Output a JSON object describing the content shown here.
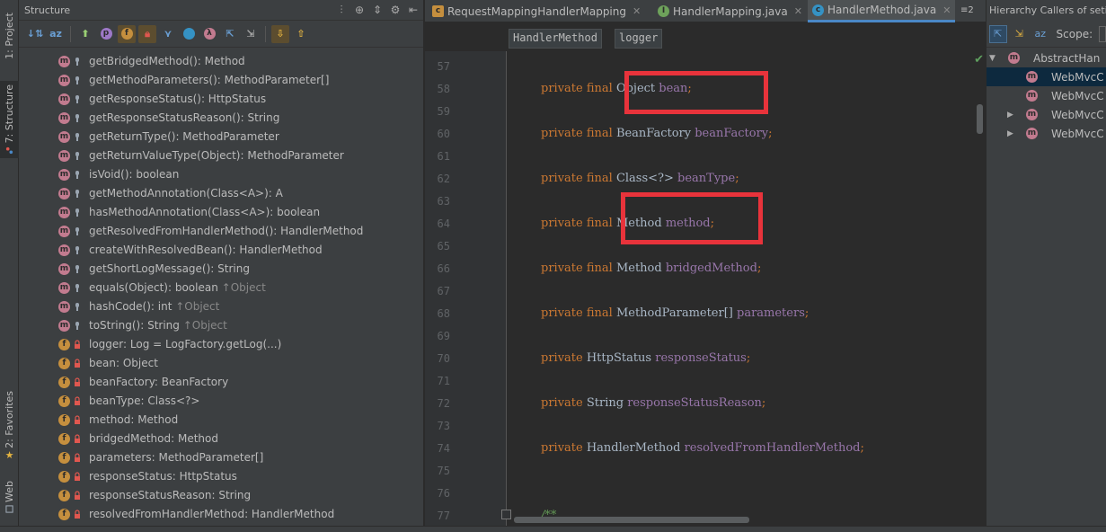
{
  "toolstrip": {
    "project_tab": "1: Project",
    "structure_tab": "7: Structure",
    "favorites_tab": "2: Favorites",
    "web_tab": "Web"
  },
  "structure": {
    "title": "Structure",
    "items": [
      {
        "kind": "m",
        "text": "getBridgedMethod(): Method",
        "inherited": ""
      },
      {
        "kind": "m",
        "text": "getMethodParameters(): MethodParameter[]",
        "inherited": ""
      },
      {
        "kind": "m",
        "text": "getResponseStatus(): HttpStatus",
        "inherited": ""
      },
      {
        "kind": "m",
        "text": "getResponseStatusReason(): String",
        "inherited": ""
      },
      {
        "kind": "m",
        "text": "getReturnType(): MethodParameter",
        "inherited": ""
      },
      {
        "kind": "m",
        "text": "getReturnValueType(Object): MethodParameter",
        "inherited": ""
      },
      {
        "kind": "m",
        "text": "isVoid(): boolean",
        "inherited": ""
      },
      {
        "kind": "m",
        "text": "getMethodAnnotation(Class<A>): A",
        "inherited": ""
      },
      {
        "kind": "m",
        "text": "hasMethodAnnotation(Class<A>): boolean",
        "inherited": ""
      },
      {
        "kind": "m",
        "text": "getResolvedFromHandlerMethod(): HandlerMethod",
        "inherited": ""
      },
      {
        "kind": "m",
        "text": "createWithResolvedBean(): HandlerMethod",
        "inherited": ""
      },
      {
        "kind": "m",
        "text": "getShortLogMessage(): String",
        "inherited": ""
      },
      {
        "kind": "m",
        "text": "equals(Object): boolean ",
        "inherited": "↑Object"
      },
      {
        "kind": "m",
        "text": "hashCode(): int ",
        "inherited": "↑Object"
      },
      {
        "kind": "m",
        "text": "toString(): String ",
        "inherited": "↑Object"
      },
      {
        "kind": "f",
        "text": "logger: Log = LogFactory.getLog(...)",
        "inherited": ""
      },
      {
        "kind": "f",
        "text": "bean: Object",
        "inherited": ""
      },
      {
        "kind": "f",
        "text": "beanFactory: BeanFactory",
        "inherited": ""
      },
      {
        "kind": "f",
        "text": "beanType: Class<?>",
        "inherited": ""
      },
      {
        "kind": "f",
        "text": "method: Method",
        "inherited": ""
      },
      {
        "kind": "f",
        "text": "bridgedMethod: Method",
        "inherited": ""
      },
      {
        "kind": "f",
        "text": "parameters: MethodParameter[]",
        "inherited": ""
      },
      {
        "kind": "f",
        "text": "responseStatus: HttpStatus",
        "inherited": ""
      },
      {
        "kind": "f",
        "text": "responseStatusReason: String",
        "inherited": ""
      },
      {
        "kind": "f",
        "text": "resolvedFromHandlerMethod: HandlerMethod",
        "inherited": ""
      }
    ]
  },
  "tabs": [
    {
      "label": "RequestMappingHandlerMapping",
      "active": false
    },
    {
      "label": "HandlerMapping.java",
      "active": false
    },
    {
      "label": "HandlerMethod.java",
      "active": true
    }
  ],
  "tab_overflow": "≡2",
  "breadcrumbs": [
    "HandlerMethod",
    "logger"
  ],
  "editor": {
    "lines": [
      {
        "n": "57",
        "tokens": []
      },
      {
        "n": "58",
        "tokens": [
          [
            "kw",
            "private final "
          ],
          [
            "ty",
            "Object "
          ],
          [
            "fd",
            "bean"
          ],
          [
            "pu",
            ";"
          ]
        ]
      },
      {
        "n": "59",
        "tokens": []
      },
      {
        "n": "60",
        "tokens": [
          [
            "kw",
            "private final "
          ],
          [
            "ty",
            "BeanFactory "
          ],
          [
            "fd",
            "beanFactory"
          ],
          [
            "pu",
            ";"
          ]
        ]
      },
      {
        "n": "61",
        "tokens": []
      },
      {
        "n": "62",
        "tokens": [
          [
            "kw",
            "private final "
          ],
          [
            "ty",
            "Class<?> "
          ],
          [
            "fd",
            "beanType"
          ],
          [
            "pu",
            ";"
          ]
        ]
      },
      {
        "n": "63",
        "tokens": []
      },
      {
        "n": "64",
        "tokens": [
          [
            "kw",
            "private final "
          ],
          [
            "ty",
            "Method "
          ],
          [
            "fd",
            "method"
          ],
          [
            "pu",
            ";"
          ]
        ]
      },
      {
        "n": "65",
        "tokens": []
      },
      {
        "n": "66",
        "tokens": [
          [
            "kw",
            "private final "
          ],
          [
            "ty",
            "Method "
          ],
          [
            "fd",
            "bridgedMethod"
          ],
          [
            "pu",
            ";"
          ]
        ]
      },
      {
        "n": "67",
        "tokens": []
      },
      {
        "n": "68",
        "tokens": [
          [
            "kw",
            "private final "
          ],
          [
            "ty",
            "MethodParameter[] "
          ],
          [
            "fd",
            "parameters"
          ],
          [
            "pu",
            ";"
          ]
        ]
      },
      {
        "n": "69",
        "tokens": []
      },
      {
        "n": "70",
        "tokens": [
          [
            "kw",
            "private "
          ],
          [
            "ty",
            "HttpStatus "
          ],
          [
            "fd",
            "responseStatus"
          ],
          [
            "pu",
            ";"
          ]
        ]
      },
      {
        "n": "71",
        "tokens": []
      },
      {
        "n": "72",
        "tokens": [
          [
            "kw",
            "private "
          ],
          [
            "ty",
            "String "
          ],
          [
            "fd",
            "responseStatusReason"
          ],
          [
            "pu",
            ";"
          ]
        ]
      },
      {
        "n": "73",
        "tokens": []
      },
      {
        "n": "74",
        "tokens": [
          [
            "kw",
            "private "
          ],
          [
            "ty",
            "HandlerMethod "
          ],
          [
            "fd",
            "resolvedFromHandlerMethod"
          ],
          [
            "pu",
            ";"
          ]
        ]
      },
      {
        "n": "75",
        "tokens": []
      },
      {
        "n": "76",
        "tokens": []
      },
      {
        "n": "77",
        "tokens": [
          [
            "cm",
            "/**"
          ]
        ]
      }
    ]
  },
  "hierarchy": {
    "title": "Hierarchy Callers of setin",
    "scope_label": "Scope:",
    "items": [
      {
        "label": "AbstractHan",
        "arrow": "▼",
        "level": 0,
        "selected": false
      },
      {
        "label": "WebMvcC",
        "arrow": "",
        "level": 1,
        "selected": true
      },
      {
        "label": "WebMvcC",
        "arrow": "",
        "level": 1,
        "selected": false
      },
      {
        "label": "WebMvcC",
        "arrow": "▶",
        "level": 1,
        "selected": false
      },
      {
        "label": "WebMvcC",
        "arrow": "▶",
        "level": 1,
        "selected": false
      }
    ]
  },
  "colors": {
    "highlight_box": "#e8333b",
    "accent": "#4a88c7"
  }
}
